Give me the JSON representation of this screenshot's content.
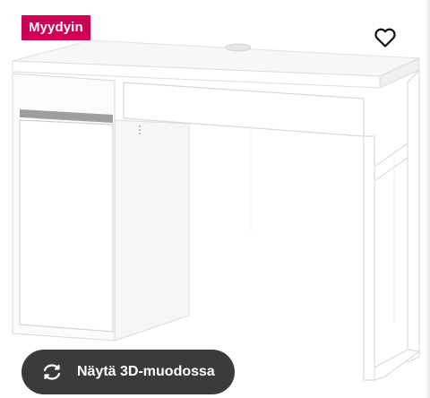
{
  "badge": {
    "label": "Myydyin",
    "color": "#cc0055"
  },
  "favorite": {
    "icon": "heart-outline-icon"
  },
  "view3d": {
    "label": "Näytä 3D-muodossa",
    "icon": "rotate-arrows-icon",
    "background": "#3b3b3b"
  },
  "product": {
    "image": "white-desk-with-drawer-and-cabinet"
  }
}
